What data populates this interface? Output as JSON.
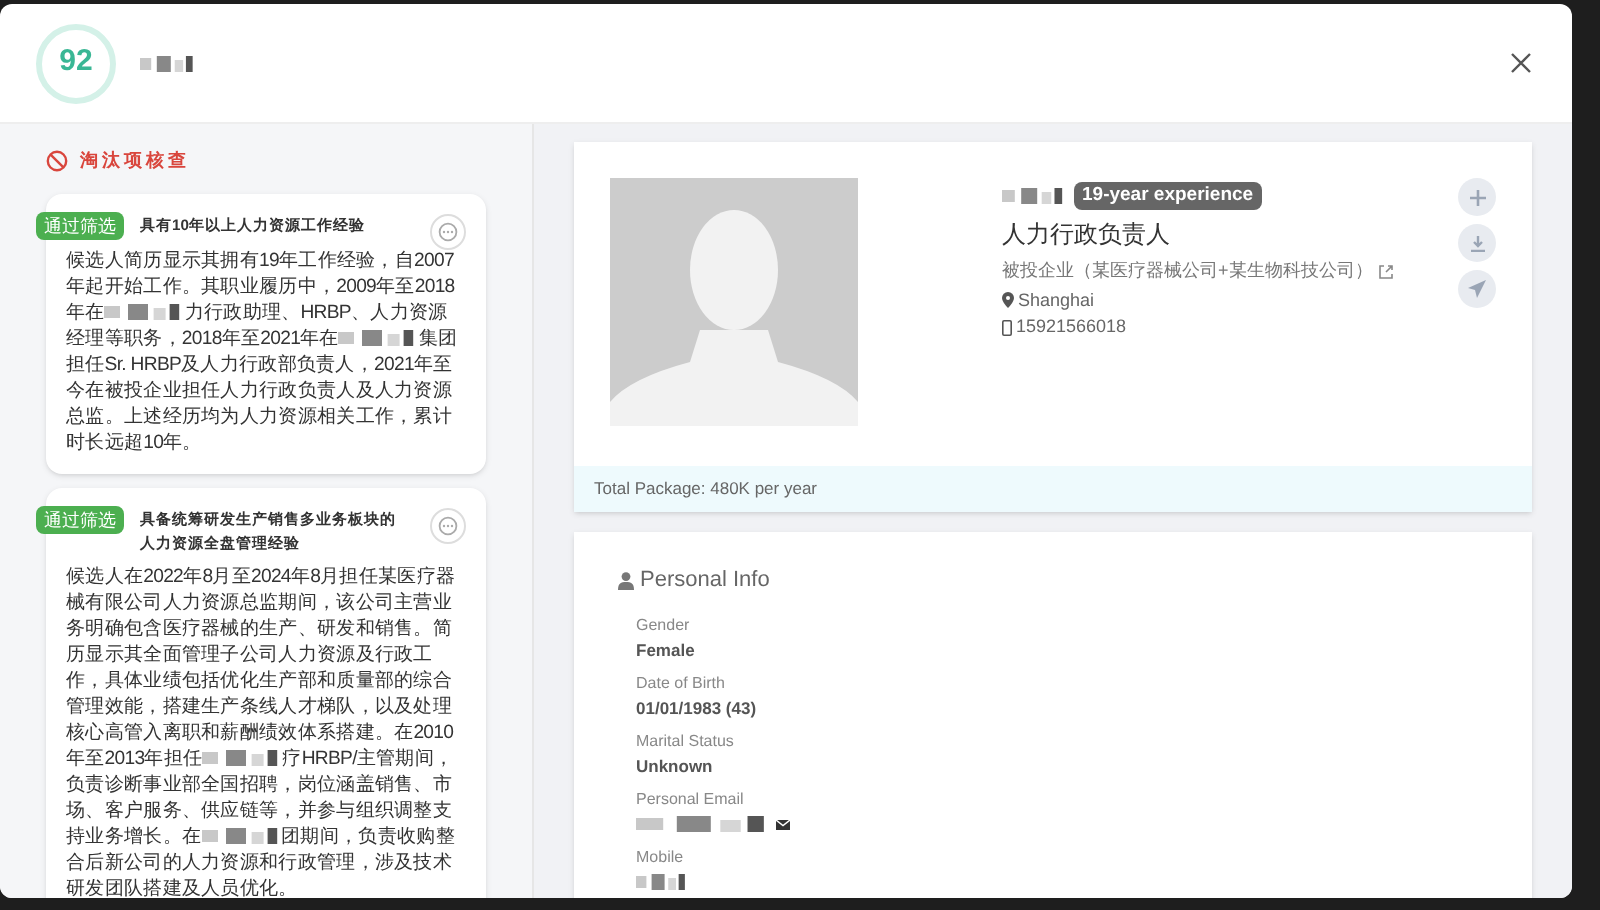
{
  "header": {
    "score": "92"
  },
  "screening": {
    "title": "淘汰项核查",
    "items": [
      {
        "badge": "通过筛选",
        "title": "具有10年以上人力资源工作经验",
        "parts": [
          {
            "kind": "text",
            "text": "候选人简历显示其拥有19年工作经验，自2007年起开始工作。其职业履历中，2009年至2018年在"
          },
          {
            "kind": "redacted"
          },
          {
            "kind": "text",
            "text": "力行政助理、HRBP、人力资源经理等职务，2018年至2021年在"
          },
          {
            "kind": "redacted"
          },
          {
            "kind": "text",
            "text": "集团担任Sr. HRBP及人力行政部负责人，2021年至今在被投企业担任人力行政负责人及人力资源总监。上述经历均为人力资源相关工作，累计时长远超10年。"
          }
        ]
      },
      {
        "badge": "通过筛选",
        "title": "具备统筹研发生产销售多业务板块的人力资源全盘管理经验",
        "parts": [
          {
            "kind": "text",
            "text": "候选人在2022年8月至2024年8月担任某医疗器械有限公司人力资源总监期间，该公司主营业务明确包含医疗器械的生产、研发和销售。简历显示其全面管理子公司人力资源及行政工作，具体业绩包括优化生产部和质量部的综合管理效能，搭建生产条线人才梯队，以及处理核心高管入离职和薪酬绩效体系搭建。在2010年至2013年担任"
          },
          {
            "kind": "redacted"
          },
          {
            "kind": "text",
            "text": "疗HRBP/主管期间，负责诊断事业部全国招聘，岗位涵盖销售、市场、客户服务、供应链等，并参与组织调整支持业务增长。在"
          },
          {
            "kind": "redacted"
          },
          {
            "kind": "text",
            "text": "团期间，负责收购整合后新公司的人力资源和行政管理，涉及技术研发团队搭建及人员优化。"
          }
        ]
      }
    ]
  },
  "profile": {
    "experience": "19-year experience",
    "position": "人力行政负责人",
    "company": "被投企业（某医疗器械公司+某生物科技公司）",
    "location": "Shanghai",
    "phone": "15921566018",
    "package": "Total Package: 480K per year"
  },
  "personal_info": {
    "title": "Personal Info",
    "fields": [
      {
        "label": "Gender",
        "value": "Female",
        "kind": "text"
      },
      {
        "label": "Date of Birth",
        "value": "01/01/1983 (43)",
        "kind": "text"
      },
      {
        "label": "Marital Status",
        "value": "Unknown",
        "kind": "text"
      },
      {
        "label": "Personal Email",
        "kind": "email"
      },
      {
        "label": "Mobile",
        "kind": "redacted"
      }
    ]
  }
}
